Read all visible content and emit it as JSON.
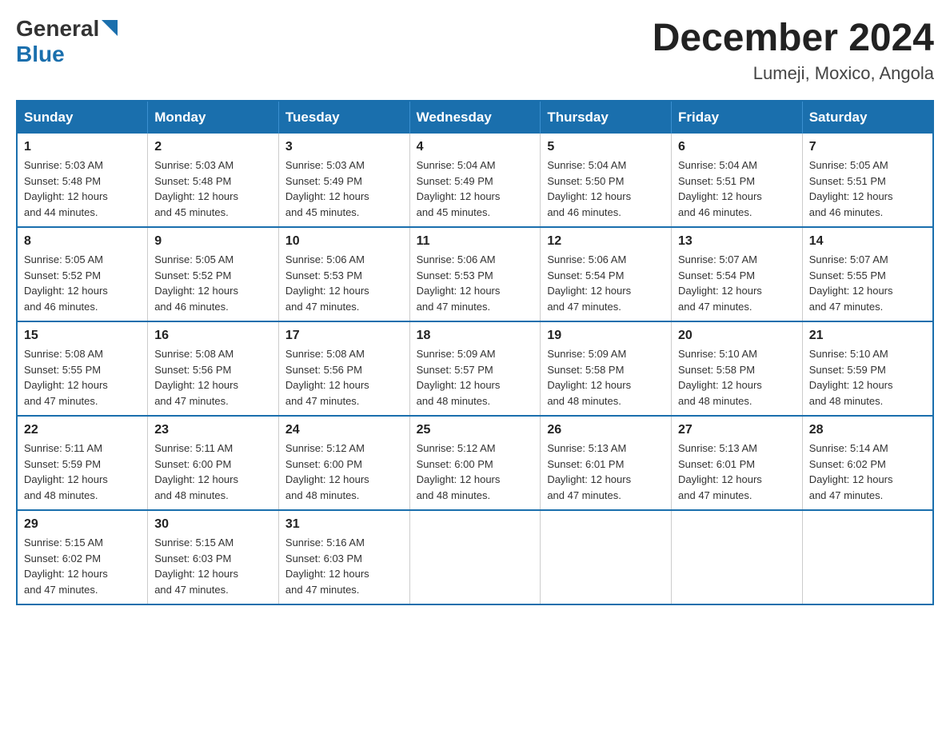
{
  "header": {
    "logo_general": "General",
    "logo_blue": "Blue",
    "month_title": "December 2024",
    "location": "Lumeji, Moxico, Angola"
  },
  "weekdays": [
    "Sunday",
    "Monday",
    "Tuesday",
    "Wednesday",
    "Thursday",
    "Friday",
    "Saturday"
  ],
  "weeks": [
    [
      {
        "day": "1",
        "sunrise": "5:03 AM",
        "sunset": "5:48 PM",
        "daylight": "12 hours and 44 minutes."
      },
      {
        "day": "2",
        "sunrise": "5:03 AM",
        "sunset": "5:48 PM",
        "daylight": "12 hours and 45 minutes."
      },
      {
        "day": "3",
        "sunrise": "5:03 AM",
        "sunset": "5:49 PM",
        "daylight": "12 hours and 45 minutes."
      },
      {
        "day": "4",
        "sunrise": "5:04 AM",
        "sunset": "5:49 PM",
        "daylight": "12 hours and 45 minutes."
      },
      {
        "day": "5",
        "sunrise": "5:04 AM",
        "sunset": "5:50 PM",
        "daylight": "12 hours and 46 minutes."
      },
      {
        "day": "6",
        "sunrise": "5:04 AM",
        "sunset": "5:51 PM",
        "daylight": "12 hours and 46 minutes."
      },
      {
        "day": "7",
        "sunrise": "5:05 AM",
        "sunset": "5:51 PM",
        "daylight": "12 hours and 46 minutes."
      }
    ],
    [
      {
        "day": "8",
        "sunrise": "5:05 AM",
        "sunset": "5:52 PM",
        "daylight": "12 hours and 46 minutes."
      },
      {
        "day": "9",
        "sunrise": "5:05 AM",
        "sunset": "5:52 PM",
        "daylight": "12 hours and 46 minutes."
      },
      {
        "day": "10",
        "sunrise": "5:06 AM",
        "sunset": "5:53 PM",
        "daylight": "12 hours and 47 minutes."
      },
      {
        "day": "11",
        "sunrise": "5:06 AM",
        "sunset": "5:53 PM",
        "daylight": "12 hours and 47 minutes."
      },
      {
        "day": "12",
        "sunrise": "5:06 AM",
        "sunset": "5:54 PM",
        "daylight": "12 hours and 47 minutes."
      },
      {
        "day": "13",
        "sunrise": "5:07 AM",
        "sunset": "5:54 PM",
        "daylight": "12 hours and 47 minutes."
      },
      {
        "day": "14",
        "sunrise": "5:07 AM",
        "sunset": "5:55 PM",
        "daylight": "12 hours and 47 minutes."
      }
    ],
    [
      {
        "day": "15",
        "sunrise": "5:08 AM",
        "sunset": "5:55 PM",
        "daylight": "12 hours and 47 minutes."
      },
      {
        "day": "16",
        "sunrise": "5:08 AM",
        "sunset": "5:56 PM",
        "daylight": "12 hours and 47 minutes."
      },
      {
        "day": "17",
        "sunrise": "5:08 AM",
        "sunset": "5:56 PM",
        "daylight": "12 hours and 47 minutes."
      },
      {
        "day": "18",
        "sunrise": "5:09 AM",
        "sunset": "5:57 PM",
        "daylight": "12 hours and 48 minutes."
      },
      {
        "day": "19",
        "sunrise": "5:09 AM",
        "sunset": "5:58 PM",
        "daylight": "12 hours and 48 minutes."
      },
      {
        "day": "20",
        "sunrise": "5:10 AM",
        "sunset": "5:58 PM",
        "daylight": "12 hours and 48 minutes."
      },
      {
        "day": "21",
        "sunrise": "5:10 AM",
        "sunset": "5:59 PM",
        "daylight": "12 hours and 48 minutes."
      }
    ],
    [
      {
        "day": "22",
        "sunrise": "5:11 AM",
        "sunset": "5:59 PM",
        "daylight": "12 hours and 48 minutes."
      },
      {
        "day": "23",
        "sunrise": "5:11 AM",
        "sunset": "6:00 PM",
        "daylight": "12 hours and 48 minutes."
      },
      {
        "day": "24",
        "sunrise": "5:12 AM",
        "sunset": "6:00 PM",
        "daylight": "12 hours and 48 minutes."
      },
      {
        "day": "25",
        "sunrise": "5:12 AM",
        "sunset": "6:00 PM",
        "daylight": "12 hours and 48 minutes."
      },
      {
        "day": "26",
        "sunrise": "5:13 AM",
        "sunset": "6:01 PM",
        "daylight": "12 hours and 47 minutes."
      },
      {
        "day": "27",
        "sunrise": "5:13 AM",
        "sunset": "6:01 PM",
        "daylight": "12 hours and 47 minutes."
      },
      {
        "day": "28",
        "sunrise": "5:14 AM",
        "sunset": "6:02 PM",
        "daylight": "12 hours and 47 minutes."
      }
    ],
    [
      {
        "day": "29",
        "sunrise": "5:15 AM",
        "sunset": "6:02 PM",
        "daylight": "12 hours and 47 minutes."
      },
      {
        "day": "30",
        "sunrise": "5:15 AM",
        "sunset": "6:03 PM",
        "daylight": "12 hours and 47 minutes."
      },
      {
        "day": "31",
        "sunrise": "5:16 AM",
        "sunset": "6:03 PM",
        "daylight": "12 hours and 47 minutes."
      },
      null,
      null,
      null,
      null
    ]
  ],
  "labels": {
    "sunrise": "Sunrise:",
    "sunset": "Sunset:",
    "daylight": "Daylight:"
  }
}
